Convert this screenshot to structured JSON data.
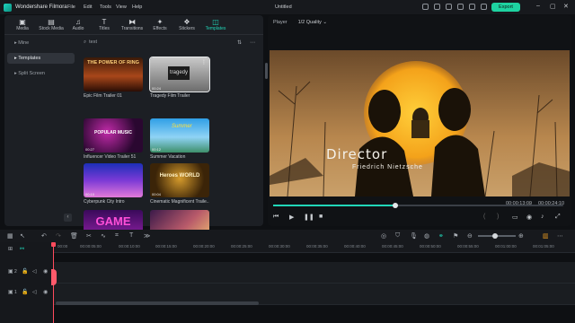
{
  "app": {
    "name": "Wondershare Filmora",
    "project_title": "Untitled",
    "export_label": "Export"
  },
  "menu": [
    "File",
    "Edit",
    "Tools",
    "View",
    "Help"
  ],
  "media_tabs": [
    {
      "label": "Media",
      "icon": "media-icon"
    },
    {
      "label": "Stock Media",
      "icon": "stock-media-icon"
    },
    {
      "label": "Audio",
      "icon": "audio-icon"
    },
    {
      "label": "Titles",
      "icon": "titles-icon"
    },
    {
      "label": "Transitions",
      "icon": "transitions-icon"
    },
    {
      "label": "Effects",
      "icon": "effects-icon"
    },
    {
      "label": "Stickers",
      "icon": "stickers-icon"
    },
    {
      "label": "Templates",
      "icon": "templates-icon",
      "active": true
    }
  ],
  "sidebar": {
    "items": [
      {
        "label": "Mine"
      },
      {
        "label": "Templates",
        "selected": true
      },
      {
        "label": "Split Screen"
      }
    ]
  },
  "search": {
    "value": "text"
  },
  "templates": [
    {
      "title": "Epic Film Trailer 01",
      "thumb_text": "THE POWER OF RING",
      "duration": ""
    },
    {
      "title": "Tragedy Film Trailer",
      "thumb_text": "tragedy",
      "duration": "00:24",
      "selected": true
    },
    {
      "title": "Influencer Video Trailer 51",
      "thumb_text": "POPULAR MUSIC",
      "duration": "00:27"
    },
    {
      "title": "Summer Vacation",
      "thumb_text": "Summer",
      "duration": "00:12"
    },
    {
      "title": "Cyberpunk City Intro",
      "thumb_text": "",
      "duration": "00:10"
    },
    {
      "title": "Cinematic Magnificent Traile...",
      "thumb_text": "Heroes WORLD",
      "duration": "00:04"
    },
    {
      "title": "",
      "thumb_text": "GAME",
      "duration": ""
    },
    {
      "title": "",
      "thumb_text": "",
      "duration": ""
    }
  ],
  "player": {
    "label": "Player",
    "quality": "1/2 Quality",
    "overlay_title": "Director",
    "overlay_subtitle": "Friedrich Nietzsche",
    "current_time": "00:00:13:09",
    "total_time": "00:00:24:10",
    "progress": 0.42
  },
  "timeline": {
    "ticks": [
      "00:00",
      "00:00:05:00",
      "00:00:10:00",
      "00:00:15:00",
      "00:00:20:00",
      "00:00:25:00",
      "00:00:30:00",
      "00:00:35:00",
      "00:00:40:00",
      "00:00:45:00",
      "00:00:50:00",
      "00:00:55:00",
      "00:01:00:00",
      "00:01:05:00"
    ],
    "tracks": [
      {
        "number": "2"
      },
      {
        "number": "1"
      }
    ]
  },
  "colors": {
    "accent": "#21d6b8",
    "export": "#1ed3a1",
    "playhead": "#ff4b5c"
  }
}
